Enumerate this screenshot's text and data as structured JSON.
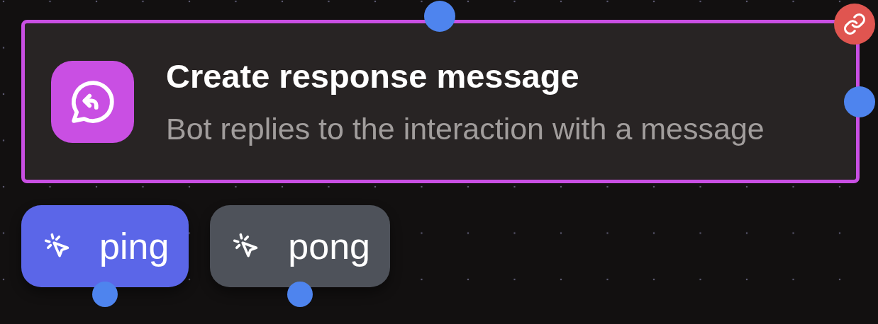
{
  "node": {
    "title": "Create response message",
    "description": "Bot replies to the interaction with a message"
  },
  "buttons": [
    {
      "label": "ping",
      "selected": true
    },
    {
      "label": "pong",
      "selected": false
    }
  ]
}
